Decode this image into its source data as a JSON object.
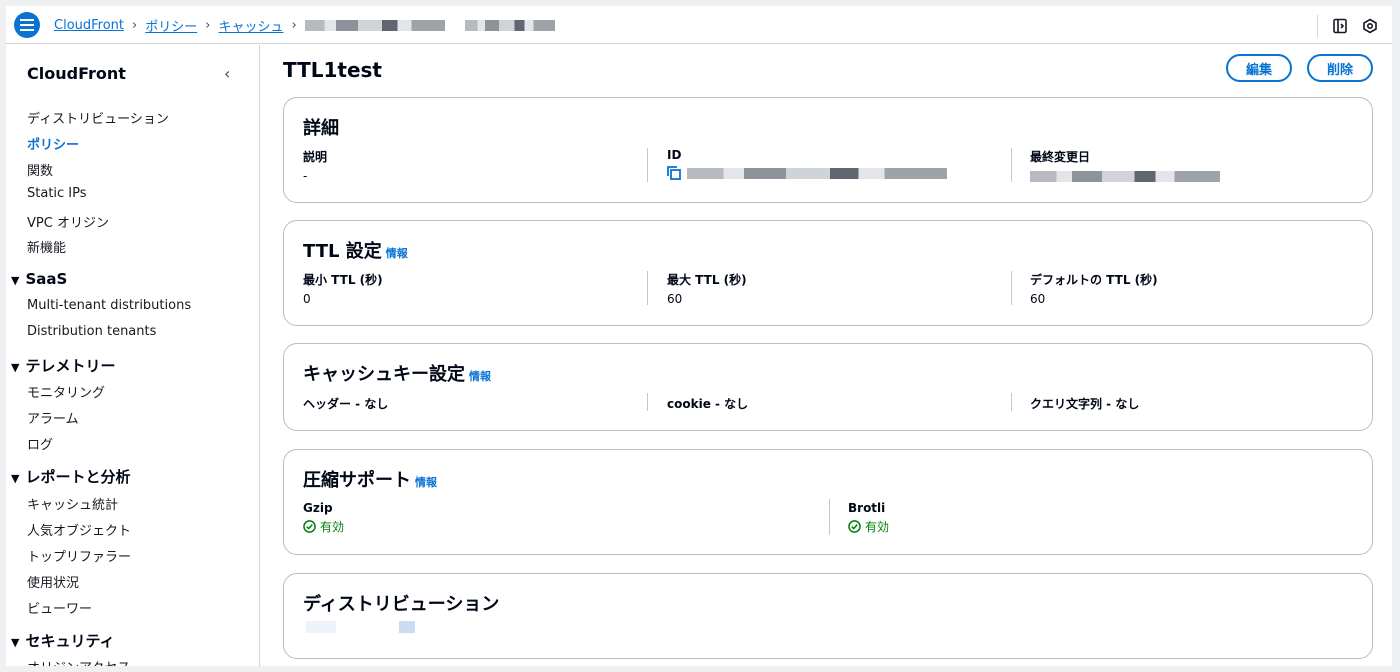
{
  "breadcrumbs": [
    "CloudFront",
    "ポリシー",
    "キャッシュ"
  ],
  "sidebar": {
    "title": "CloudFront",
    "items": [
      "ディストリビューション",
      "ポリシー",
      "関数",
      "Static IPs",
      "VPC オリジン",
      "新機能"
    ],
    "groups": [
      {
        "label": "SaaS",
        "items": [
          "Multi-tenant distributions",
          "Distribution tenants"
        ]
      },
      {
        "label": "テレメトリー",
        "items": [
          "モニタリング",
          "アラーム",
          "ログ"
        ]
      },
      {
        "label": "レポートと分析",
        "items": [
          "キャッシュ統計",
          "人気オブジェクト",
          "トップリファラー",
          "使用状況",
          "ビューワー"
        ]
      },
      {
        "label": "セキュリティ",
        "items": [
          "オリジンアクセス"
        ]
      }
    ]
  },
  "page": {
    "title": "TTL1test",
    "edit_label": "編集",
    "delete_label": "削除",
    "info_label": "情報"
  },
  "details": {
    "title": "詳細",
    "description_label": "説明",
    "description_value": "-",
    "id_label": "ID",
    "modified_label": "最終変更日"
  },
  "ttl": {
    "title": "TTL 設定",
    "min_label": "最小 TTL (秒)",
    "min_value": "0",
    "max_label": "最大 TTL (秒)",
    "max_value": "60",
    "default_label": "デフォルトの TTL (秒)",
    "default_value": "60"
  },
  "cache_key": {
    "title": "キャッシュキー設定",
    "headers": "ヘッダー - なし",
    "cookies": "cookie - なし",
    "query": "クエリ文字列 - なし"
  },
  "compression": {
    "title": "圧縮サポート",
    "gzip_label": "Gzip",
    "gzip_value": "有効",
    "brotli_label": "Brotli",
    "brotli_value": "有効"
  },
  "distributions": {
    "title": "ディストリビューション"
  },
  "colors": {
    "accent": "#0972d3",
    "success": "#037f0c",
    "border": "#b6bec9"
  }
}
